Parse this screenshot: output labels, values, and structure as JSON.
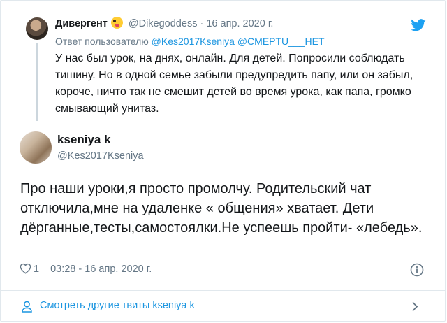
{
  "parent_tweet": {
    "display_name": "Дивергент",
    "emoji": "😜",
    "handle": "@Dikegoddess",
    "separator": "·",
    "date": "16 апр. 2020 г.",
    "reply_prefix": "Ответ пользователю",
    "reply_mentions": "@Kes2017Kseniya @CMEPTU___HET",
    "text": "У нас был урок, на днях, онлайн. Для детей.  Попросили соблюдать тишину. Но в одной семье забыли предупредить папу, или он забыл, короче, ничто так не смешит детей во время урока, как папа, громко смывающий унитаз."
  },
  "tweet": {
    "display_name": "kseniya k",
    "handle": "@Kes2017Kseniya",
    "text": "Про наши уроки,я просто промолчу. Родительский чат отключила,мне на удаленке « общения» хватает. Дети дёрганные,тесты,самостоялки.Не успеешь пройти- «лебедь».",
    "like_count": "1",
    "timestamp": "03:28 - 16 апр. 2020 г."
  },
  "footer": {
    "more_tweets_label": "Смотреть другие твиты kseniya k"
  },
  "icons": {
    "brand": "twitter-bird-icon",
    "like": "heart-icon",
    "info": "info-icon",
    "person": "person-icon",
    "chevron": "chevron-right-icon"
  },
  "colors": {
    "brand_blue": "#1da1f2",
    "link_blue": "#1b95e0",
    "secondary_text": "#657786",
    "border": "#e1e8ed"
  }
}
